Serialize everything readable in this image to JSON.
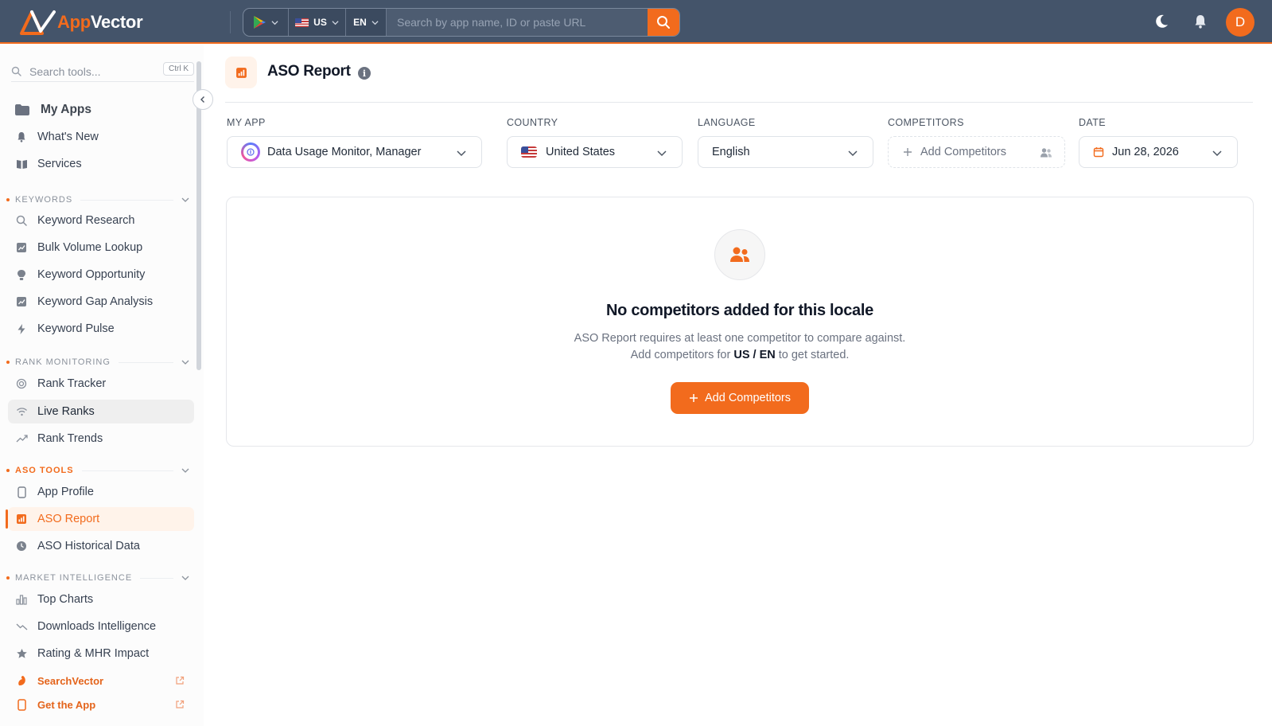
{
  "colors": {
    "accent": "#f26b1d",
    "topbar": "#44546a",
    "active_bg": "#fff3ea"
  },
  "brand": {
    "app": "App",
    "vector": "Vector"
  },
  "topbar": {
    "store_icon": "google-play-icon",
    "country": "US",
    "language": "EN",
    "search_placeholder": "Search by app name, ID or paste URL",
    "avatar_initial": "D"
  },
  "sidebar": {
    "search_placeholder": "Search tools...",
    "shortcut": "Ctrl K",
    "top_items": [
      {
        "label": "My Apps",
        "icon": "folder-icon"
      },
      {
        "label": "What's New",
        "icon": "bell-icon"
      },
      {
        "label": "Services",
        "icon": "book-icon"
      }
    ],
    "sections": {
      "keywords": {
        "title": "KEYWORDS",
        "items": [
          {
            "label": "Keyword Research",
            "icon": "search-icon"
          },
          {
            "label": "Bulk Volume Lookup",
            "icon": "chart-icon"
          },
          {
            "label": "Keyword Opportunity",
            "icon": "lightbulb-icon"
          },
          {
            "label": "Keyword Gap Analysis",
            "icon": "chart-icon"
          },
          {
            "label": "Keyword Pulse",
            "icon": "bolt-icon"
          }
        ]
      },
      "rank": {
        "title": "RANK MONITORING",
        "items": [
          {
            "label": "Rank Tracker",
            "icon": "target-icon"
          },
          {
            "label": "Live Ranks",
            "icon": "wifi-icon"
          },
          {
            "label": "Rank Trends",
            "icon": "trend-icon"
          }
        ]
      },
      "aso": {
        "title": "ASO TOOLS",
        "items": [
          {
            "label": "App Profile",
            "icon": "phone-icon"
          },
          {
            "label": "ASO Report",
            "icon": "report-icon"
          },
          {
            "label": "ASO Historical Data",
            "icon": "clock-icon"
          }
        ]
      },
      "market": {
        "title": "MARKET INTELLIGENCE",
        "items": [
          {
            "label": "Top Charts",
            "icon": "bar-chart-icon"
          },
          {
            "label": "Downloads Intelligence",
            "icon": "trend-down-icon"
          },
          {
            "label": "Rating & MHR Impact",
            "icon": "star-icon"
          }
        ]
      }
    },
    "external": [
      {
        "label": "SearchVector",
        "icon": "searchvector-logo-icon"
      },
      {
        "label": "Get the App",
        "icon": "phone-icon"
      }
    ]
  },
  "page": {
    "title": "ASO Report",
    "filters": {
      "my_app": {
        "label": "MY APP",
        "value": "Data Usage Monitor, Manager"
      },
      "country": {
        "label": "COUNTRY",
        "value": "United States"
      },
      "language": {
        "label": "LANGUAGE",
        "value": "English"
      },
      "competitors": {
        "label": "COMPETITORS",
        "value": "Add Competitors"
      },
      "date": {
        "label": "DATE",
        "value": "Jun 28, 2026"
      }
    },
    "empty_state": {
      "title": "No competitors added for this locale",
      "line1": "ASO Report requires at least one competitor to compare against.",
      "line2_prefix": "Add competitors for",
      "locale": "US / EN",
      "line2_suffix": "to get started.",
      "button": "Add Competitors"
    }
  }
}
